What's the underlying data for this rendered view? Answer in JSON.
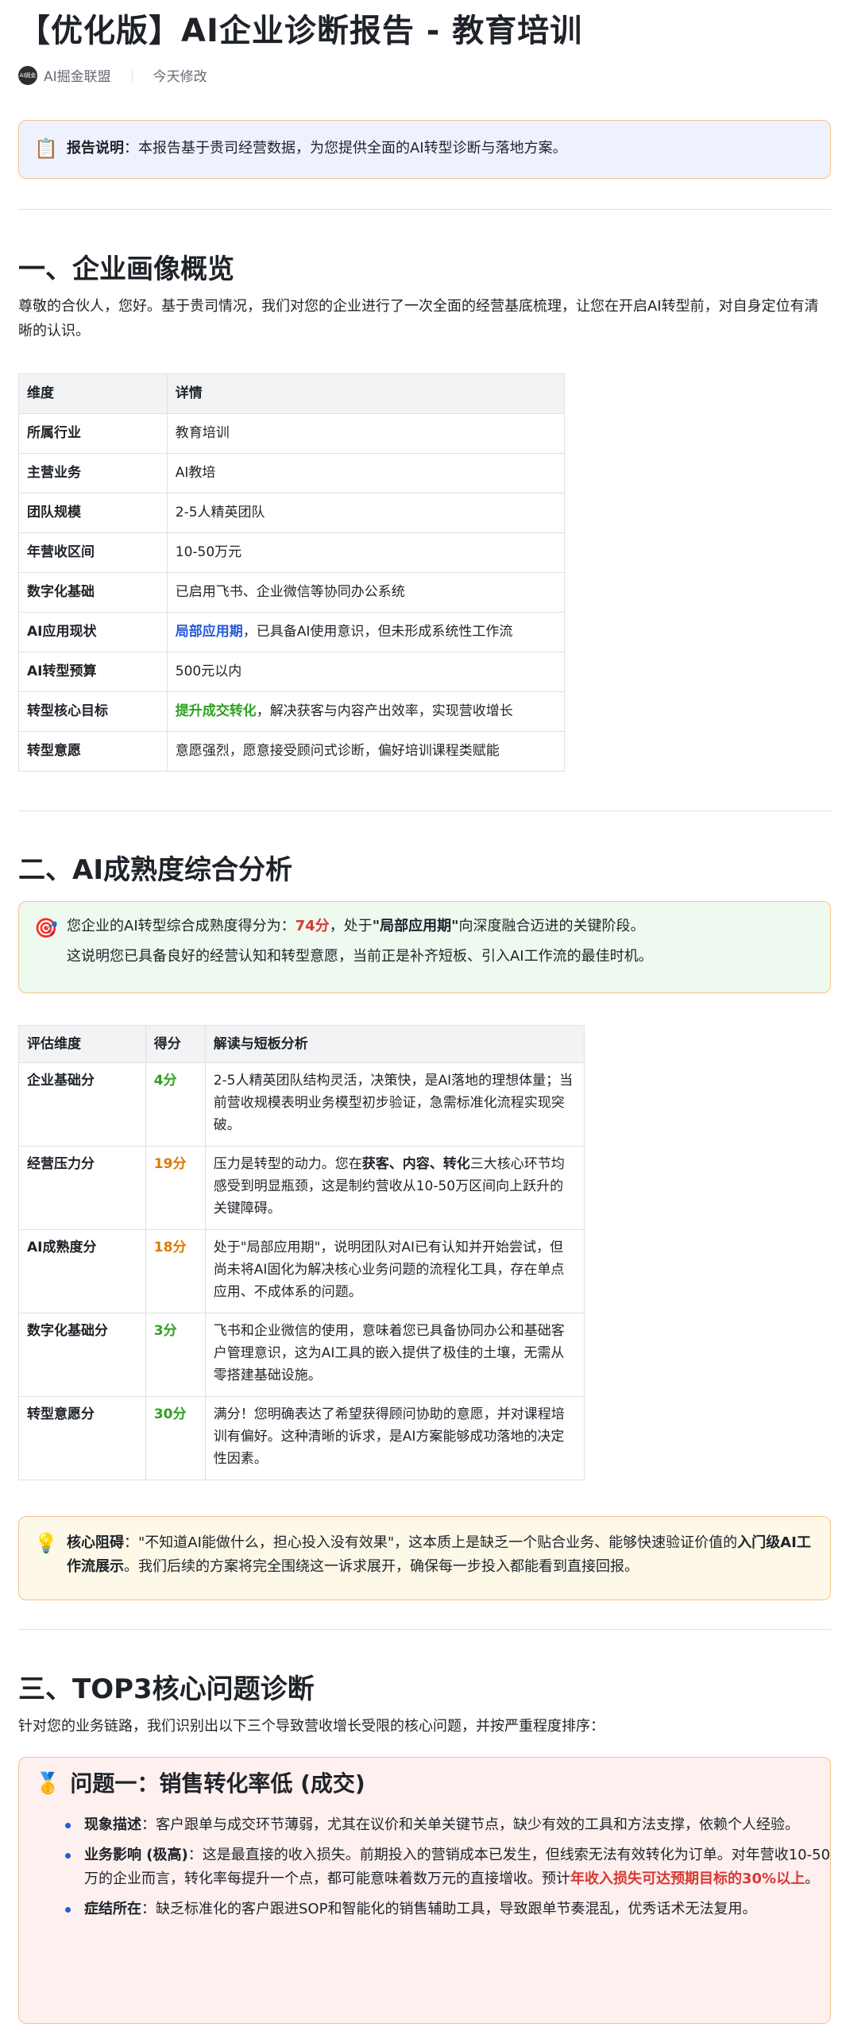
{
  "doc": {
    "title": "【优化版】AI企业诊断报告 - 教育培训",
    "author": "AI掘金联盟",
    "modified": "今天修改"
  },
  "report_note": {
    "label": "报告说明",
    "text": "：本报告基于贵司经营数据，为您提供全面的AI转型诊断与落地方案。"
  },
  "section1": {
    "heading": "一、企业画像概览",
    "intro": "尊敬的合伙人，您好。基于贵司情况，我们对您的企业进行了一次全面的经营基底梳理，让您在开启AI转型前，对自身定位有清晰的认识。",
    "table": {
      "headers": [
        "维度",
        "详情"
      ],
      "rows": [
        {
          "k": "所属行业",
          "v": "教育培训"
        },
        {
          "k": "主营业务",
          "v": "AI教培"
        },
        {
          "k": "团队规模",
          "v": "2-5人精英团队"
        },
        {
          "k": "年营收区间",
          "v": "10-50万元"
        },
        {
          "k": "数字化基础",
          "v": "已启用飞书、企业微信等协同办公系统"
        },
        {
          "k": "AI应用现状",
          "hl": "局部应用期",
          "v": "，已具备AI使用意识，但未形成系统性工作流"
        },
        {
          "k": "AI转型预算",
          "v": "500元以内"
        },
        {
          "k": "转型核心目标",
          "hl": "提升成交转化",
          "v": "，解决获客与内容产出效率，实现营收增长"
        },
        {
          "k": "转型意愿",
          "v": "意愿强烈，愿意接受顾问式诊断，偏好培训课程类赋能"
        }
      ]
    }
  },
  "section2": {
    "heading": "二、AI成熟度综合分析",
    "score_line_a": "您企业的AI转型综合成熟度得分为：",
    "score": "74分",
    "score_line_b": "，处于",
    "stage": "\"局部应用期\"",
    "score_line_c": "向深度融合迈进的关键阶段。",
    "score_line2": "这说明您已具备良好的经营认知和转型意愿，当前正是补齐短板、引入AI工作流的最佳时机。",
    "table": {
      "headers": [
        "评估维度",
        "得分",
        "解读与短板分析"
      ],
      "rows": [
        {
          "dim": "企业基础分",
          "score": "4分",
          "color": "green",
          "text": "2-5人精英团队结构灵活，决策快，是AI落地的理想体量；当前营收规模表明业务模型初步验证，急需标准化流程实现突破。"
        },
        {
          "dim": "经营压力分",
          "score": "19分",
          "color": "orange",
          "text_a": "压力是转型的动力。您在",
          "text_b": "获客、内容、转化",
          "text_c": "三大核心环节均感受到明显瓶颈，这是制约营收从10-50万区间向上跃升的关键障碍。"
        },
        {
          "dim": "AI成熟度分",
          "score": "18分",
          "color": "orange",
          "text": "处于\"局部应用期\"，说明团队对AI已有认知并开始尝试，但尚未将AI固化为解决核心业务问题的流程化工具，存在单点应用、不成体系的问题。"
        },
        {
          "dim": "数字化基础分",
          "score": "3分",
          "color": "green",
          "text": "飞书和企业微信的使用，意味着您已具备协同办公和基础客户管理意识，这为AI工具的嵌入提供了极佳的土壤，无需从零搭建基础设施。"
        },
        {
          "dim": "转型意愿分",
          "score": "30分",
          "color": "green",
          "text": "满分！您明确表达了希望获得顾问协助的意愿，并对课程培训有偏好。这种清晰的诉求，是AI方案能够成功落地的决定性因素。"
        }
      ]
    },
    "block": {
      "label": "核心阻碍",
      "text_a": "：\"不知道AI能做什么，担心投入没有效果\"，这本质上是缺乏一个贴合业务、能够快速验证价值的",
      "bold": "入门级AI工作流展示",
      "text_b": "。我们后续的方案将完全围绕这一诉求展开，确保每一步投入都能看到直接回报。"
    }
  },
  "section3": {
    "heading": "三、TOP3核心问题诊断",
    "intro": "针对您的业务链路，我们识别出以下三个导致营收增长受限的核心问题，并按严重程度排序：",
    "issue1": {
      "title": "问题一：销售转化率低 (成交)",
      "items": [
        {
          "label": "现象描述",
          "text": "：客户跟单与成交环节薄弱，尤其在议价和关单关键节点，缺少有效的工具和方法支撑，依赖个人经验。"
        },
        {
          "label": "业务影响 (极高)",
          "text": "：这是最直接的收入损失。前期投入的营销成本已发生，但线索无法有效转化为订单。对年营收10-50万的企业而言，转化率每提升一个点，都可能意味着数万元的直接增收。预计",
          "red": "年收入损失可达预期目标的30%以上",
          "tail": "。"
        },
        {
          "label": "症结所在",
          "text": "：缺乏标准化的客户跟进SOP和智能化的销售辅助工具，导致跟单节奏混乱，优秀话术无法复用。"
        }
      ]
    }
  },
  "icons": {
    "note": "clipboard-icon",
    "target": "target-icon",
    "bulb": "lightbulb-icon",
    "medal": "medal-icon"
  },
  "colors": {
    "blue": "#245bdb",
    "green": "#2ea121",
    "orange": "#de7802",
    "red": "#d83931"
  }
}
